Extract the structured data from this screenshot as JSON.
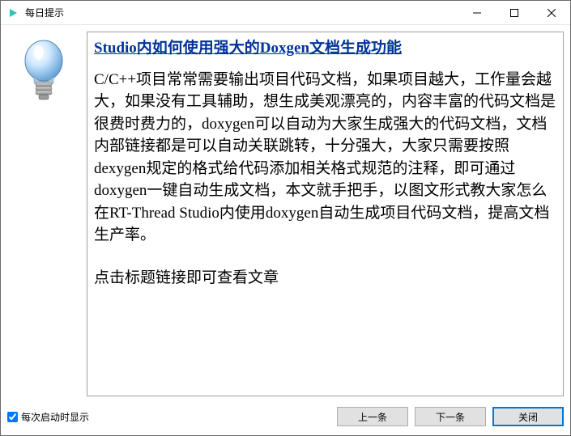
{
  "window": {
    "title": "每日提示"
  },
  "tip": {
    "title": "Studio内如何使用强大的Doxgen文档生成功能",
    "body": "C/C++项目常常需要输出项目代码文档，如果项目越大，工作量会越大，如果没有工具辅助，想生成美观漂亮的，内容丰富的代码文档是很费时费力的，doxygen可以自动为大家生成强大的代码文档，文档内部链接都是可以自动关联跳转，十分强大，大家只需要按照dexygen规定的格式给代码添加相关格式规范的注释，即可通过doxygen一键自动生成文档，本文就手把手，以图文形式教大家怎么在RT-Thread Studio内使用doxygen自动生成项目代码文档，提高文档生产率。",
    "footer": "点击标题链接即可查看文章"
  },
  "footer": {
    "checkbox_label": "每次启动时显示",
    "checkbox_checked": true,
    "prev_label": "上一条",
    "next_label": "下一条",
    "close_label": "关闭"
  }
}
